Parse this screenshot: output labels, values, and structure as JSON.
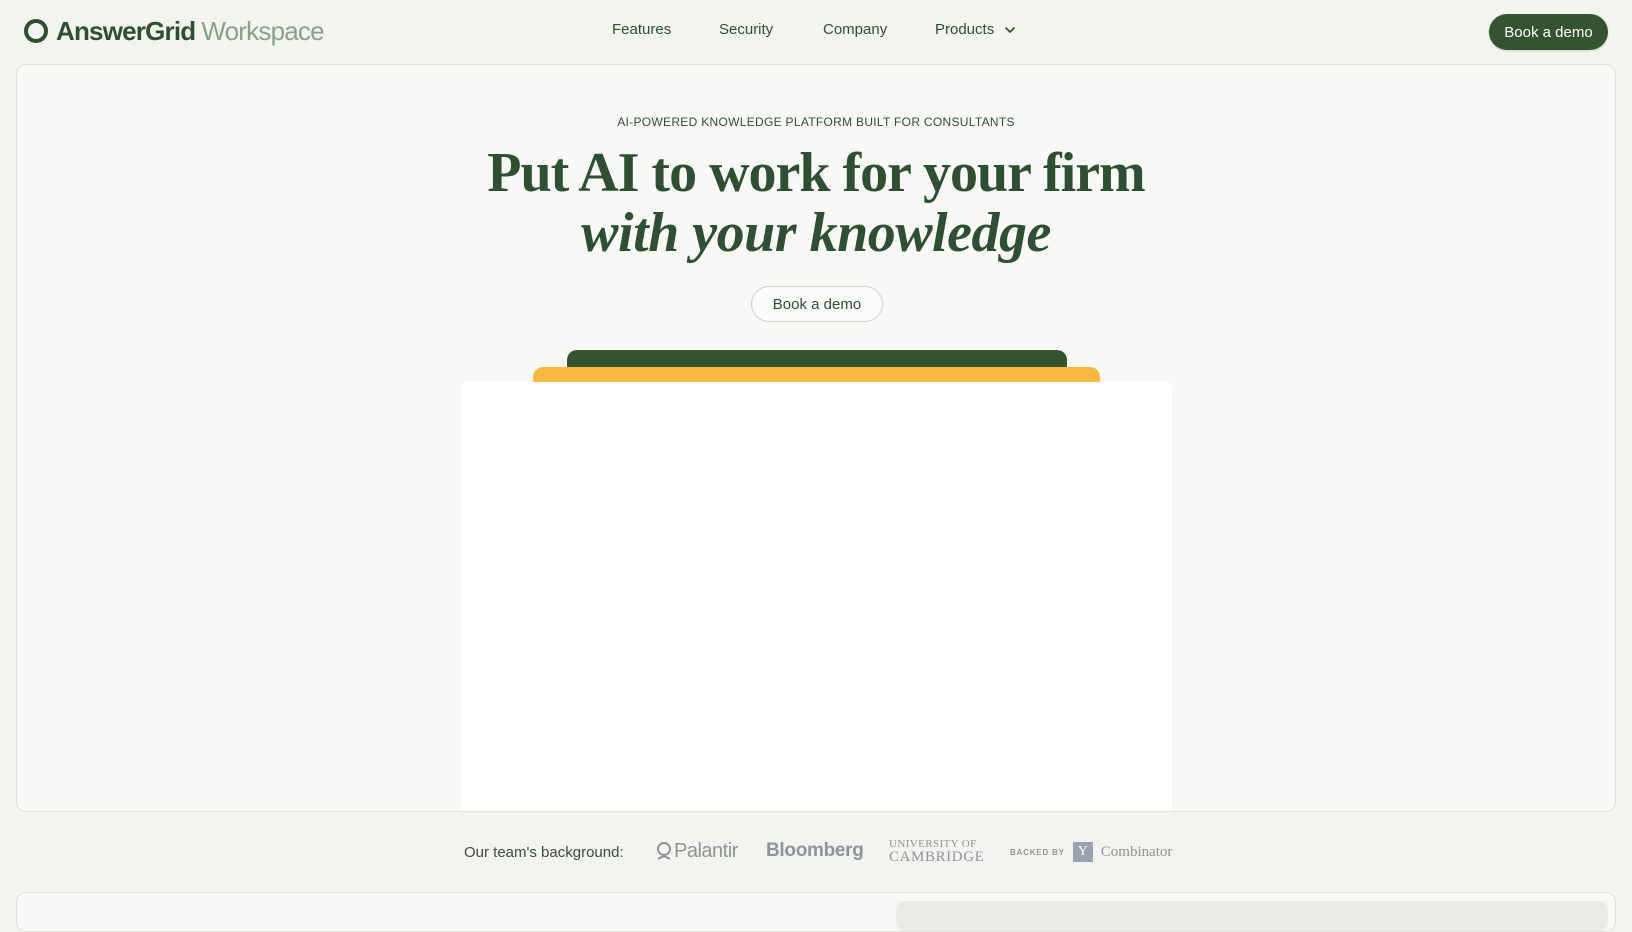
{
  "brand": {
    "name": "AnswerGrid",
    "suffix": "Workspace"
  },
  "nav": {
    "items": [
      {
        "label": "Features"
      },
      {
        "label": "Security"
      },
      {
        "label": "Company"
      },
      {
        "label": "Products",
        "icon": "chevron-down-icon"
      }
    ],
    "cta_label": "Book a demo"
  },
  "hero": {
    "eyebrow": "AI-POWERED KNOWLEDGE PLATFORM BUILT FOR CONSULTANTS",
    "headline_line1": "Put AI to work for your firm",
    "headline_line2": "with your knowledge",
    "cta_label": "Book a demo"
  },
  "logos": {
    "label": "Our team's background:",
    "items": [
      {
        "name": "Palantir",
        "icon": "palantir-logo"
      },
      {
        "name": "Bloomberg"
      },
      {
        "name_top": "UNIVERSITY OF",
        "name_bottom": "CAMBRIDGE"
      },
      {
        "backed_by": "BACKED BY",
        "mark": "Y",
        "name": "Combinator"
      }
    ]
  },
  "colors": {
    "brand_green": "#34532f",
    "brand_light": "#8ba08a",
    "accent_yellow": "#f9b844",
    "page_bg": "#f3f3f0",
    "card_bg": "#f8f8f6"
  }
}
